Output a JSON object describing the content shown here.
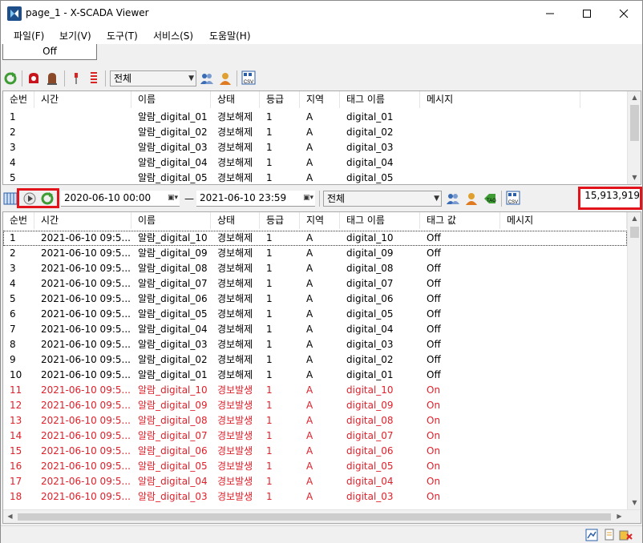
{
  "window": {
    "title": "page_1 - X-SCADA Viewer"
  },
  "menu": [
    "파일(F)",
    "보기(V)",
    "도구(T)",
    "서비스(S)",
    "도움말(H)"
  ],
  "off_label": "Off",
  "toolbar1": {
    "filter_value": "전체",
    "csv_label": "CSV"
  },
  "top_table": {
    "columns": [
      "순번",
      "시간",
      "이름",
      "상태",
      "등급",
      "지역",
      "태그 이름",
      "메시지"
    ],
    "rows": [
      [
        "1",
        "",
        "알람_digital_01",
        "경보해제",
        "1",
        "A",
        "digital_01",
        ""
      ],
      [
        "2",
        "",
        "알람_digital_02",
        "경보해제",
        "1",
        "A",
        "digital_02",
        ""
      ],
      [
        "3",
        "",
        "알람_digital_03",
        "경보해제",
        "1",
        "A",
        "digital_03",
        ""
      ],
      [
        "4",
        "",
        "알람_digital_04",
        "경보해제",
        "1",
        "A",
        "digital_04",
        ""
      ],
      [
        "5",
        "",
        "알람_digital_05",
        "경보해제",
        "1",
        "A",
        "digital_05",
        ""
      ]
    ]
  },
  "toolbar2": {
    "start_date": "2020-06-10 00:00",
    "dash": "—",
    "end_date": "2021-06-10 23:59",
    "filter_value": "전체",
    "tag_label": "TAG",
    "csv_label": "CSV",
    "count": "15,913,919"
  },
  "bottom_table": {
    "columns": [
      "순번",
      "시간",
      "이름",
      "상태",
      "등급",
      "지역",
      "태그 이름",
      "태그 값",
      "메시지"
    ],
    "rows": [
      [
        "1",
        "2021-06-10 09:5...",
        "알람_digital_10",
        "경보해제",
        "1",
        "A",
        "digital_10",
        "Off",
        ""
      ],
      [
        "2",
        "2021-06-10 09:5...",
        "알람_digital_09",
        "경보해제",
        "1",
        "A",
        "digital_09",
        "Off",
        ""
      ],
      [
        "3",
        "2021-06-10 09:5...",
        "알람_digital_08",
        "경보해제",
        "1",
        "A",
        "digital_08",
        "Off",
        ""
      ],
      [
        "4",
        "2021-06-10 09:5...",
        "알람_digital_07",
        "경보해제",
        "1",
        "A",
        "digital_07",
        "Off",
        ""
      ],
      [
        "5",
        "2021-06-10 09:5...",
        "알람_digital_06",
        "경보해제",
        "1",
        "A",
        "digital_06",
        "Off",
        ""
      ],
      [
        "6",
        "2021-06-10 09:5...",
        "알람_digital_05",
        "경보해제",
        "1",
        "A",
        "digital_05",
        "Off",
        ""
      ],
      [
        "7",
        "2021-06-10 09:5...",
        "알람_digital_04",
        "경보해제",
        "1",
        "A",
        "digital_04",
        "Off",
        ""
      ],
      [
        "8",
        "2021-06-10 09:5...",
        "알람_digital_03",
        "경보해제",
        "1",
        "A",
        "digital_03",
        "Off",
        ""
      ],
      [
        "9",
        "2021-06-10 09:5...",
        "알람_digital_02",
        "경보해제",
        "1",
        "A",
        "digital_02",
        "Off",
        ""
      ],
      [
        "10",
        "2021-06-10 09:5...",
        "알람_digital_01",
        "경보해제",
        "1",
        "A",
        "digital_01",
        "Off",
        ""
      ],
      [
        "11",
        "2021-06-10 09:5...",
        "알람_digital_10",
        "경보발생",
        "1",
        "A",
        "digital_10",
        "On",
        ""
      ],
      [
        "12",
        "2021-06-10 09:5...",
        "알람_digital_09",
        "경보발생",
        "1",
        "A",
        "digital_09",
        "On",
        ""
      ],
      [
        "13",
        "2021-06-10 09:5...",
        "알람_digital_08",
        "경보발생",
        "1",
        "A",
        "digital_08",
        "On",
        ""
      ],
      [
        "14",
        "2021-06-10 09:5...",
        "알람_digital_07",
        "경보발생",
        "1",
        "A",
        "digital_07",
        "On",
        ""
      ],
      [
        "15",
        "2021-06-10 09:5...",
        "알람_digital_06",
        "경보발생",
        "1",
        "A",
        "digital_06",
        "On",
        ""
      ],
      [
        "16",
        "2021-06-10 09:5...",
        "알람_digital_05",
        "경보발생",
        "1",
        "A",
        "digital_05",
        "On",
        ""
      ],
      [
        "17",
        "2021-06-10 09:5...",
        "알람_digital_04",
        "경보발생",
        "1",
        "A",
        "digital_04",
        "On",
        ""
      ],
      [
        "18",
        "2021-06-10 09:5...",
        "알람_digital_03",
        "경보발생",
        "1",
        "A",
        "digital_03",
        "On",
        ""
      ]
    ],
    "active_status": "경보발생"
  },
  "colors": {
    "alarm_red": "#e0202a",
    "highlight_red": "#e2131b"
  }
}
